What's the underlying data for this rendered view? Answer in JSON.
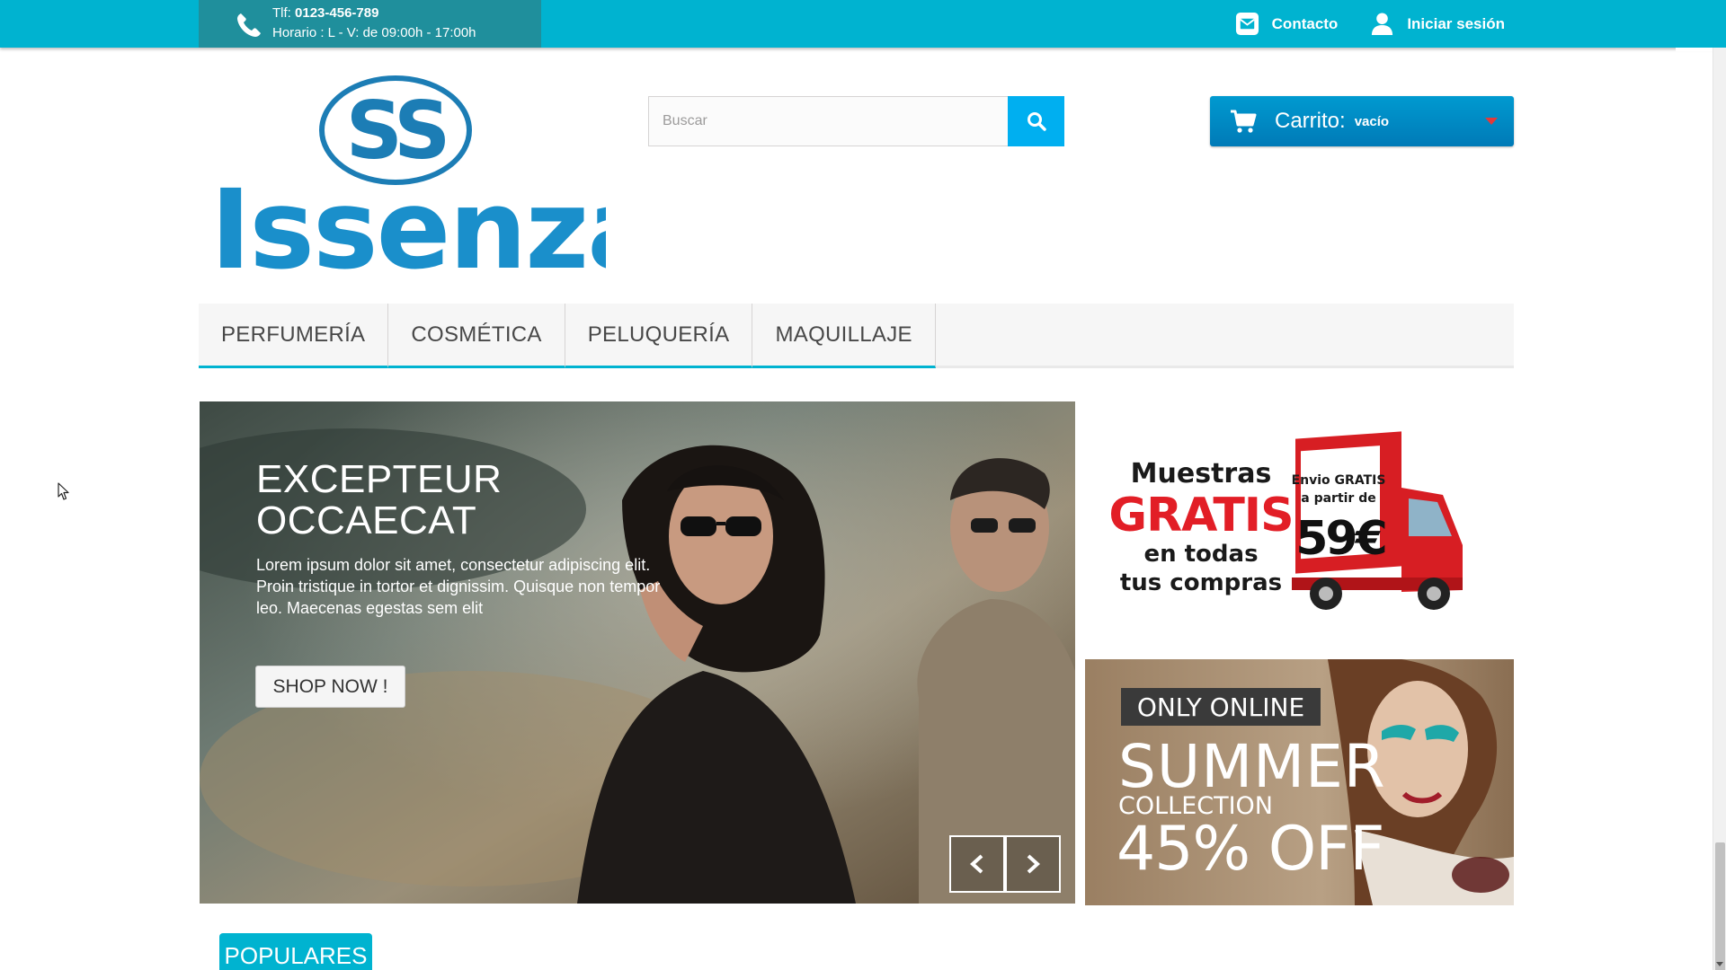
{
  "topbar": {
    "phone_label": "Tlf:",
    "phone_number": "0123-456-789",
    "hours": "Horario : L - V: de 09:00h - 17:00h",
    "contact_label": "Contacto",
    "login_label": "Iniciar sesión",
    "color": "#00b3d0"
  },
  "header": {
    "logo_text": "Issenza",
    "search": {
      "placeholder": "Buscar",
      "value": ""
    },
    "cart": {
      "label": "Carrito:",
      "status": "vacío"
    }
  },
  "menu": {
    "items": [
      {
        "label": "PERFUMERÍA"
      },
      {
        "label": "COSMÉTICA"
      },
      {
        "label": "PELUQUERÍA"
      },
      {
        "label": "MAQUILLAJE"
      }
    ]
  },
  "slider": {
    "title_line1": "EXCEPTEUR",
    "title_line2": "OCCAECAT",
    "text": "Lorem ipsum dolor sit amet, consectetur adipiscing elit. Proin tristique in tortor et dignissim. Quisque non tempor leo. Maecenas egestas sem elit",
    "button_label": "SHOP NOW !"
  },
  "banner1": {
    "line1": "Muestras",
    "line2": "GRATIS",
    "line3": "en todas",
    "line4": "tus compras",
    "truck_line1": "Envio GRATIS",
    "truck_line2": "a partir de",
    "truck_price": "59€"
  },
  "banner2": {
    "tag": "ONLY ONLINE",
    "title": "SUMMER",
    "subtitle": "COLLECTION",
    "discount": "45% OFF"
  },
  "tabs": {
    "populares": "POPULARES"
  }
}
